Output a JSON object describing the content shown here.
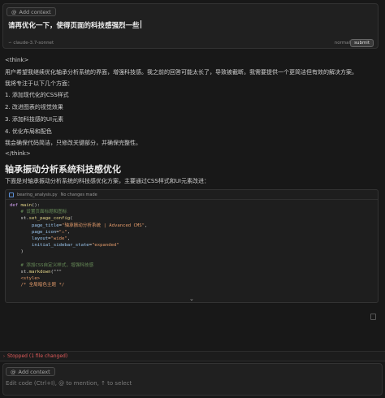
{
  "composer_top": {
    "add_context_label": "Add context",
    "prompt_text": "请再优化一下，使得页面的科技感强烈一些",
    "model_label": "∽ claude-3.7-sonnet",
    "mode_label": "normal",
    "submit_label": "submit"
  },
  "response": {
    "think_open": "<think>",
    "line1": "用户希望我继续优化轴承分析系统的界面，增强科技感。我之前的回答可能太长了，导致被截断。我需要提供一个更简洁但有效的解决方案。",
    "line2": "我将专注于以下几个方面：",
    "items": [
      "1. 添加现代化的CSS样式",
      "2. 改进图表的视觉效果",
      "3. 添加科技感的UI元素",
      "4. 优化布局和配色"
    ],
    "line3": "我会确保代码简洁，只修改关键部分，并确保完整性。",
    "think_close": "</think>",
    "heading": "轴承振动分析系统科技感优化",
    "intro": "下面是对轴承振动分析系统的科技感优化方案，主要通过CSS样式和UI元素改进："
  },
  "code_block": {
    "filename": "bearing_analysis.py",
    "status": "No changes made"
  },
  "stopped_label": "Stopped (1 file changed)",
  "composer_bottom": {
    "add_context_label": "Add context",
    "placeholder": "Edit code (Ctrl+I), @ to mention, ↑ to select"
  },
  "colors": {
    "background": "#181818",
    "panel": "#202020",
    "stopped_red": "#e05a5a"
  }
}
